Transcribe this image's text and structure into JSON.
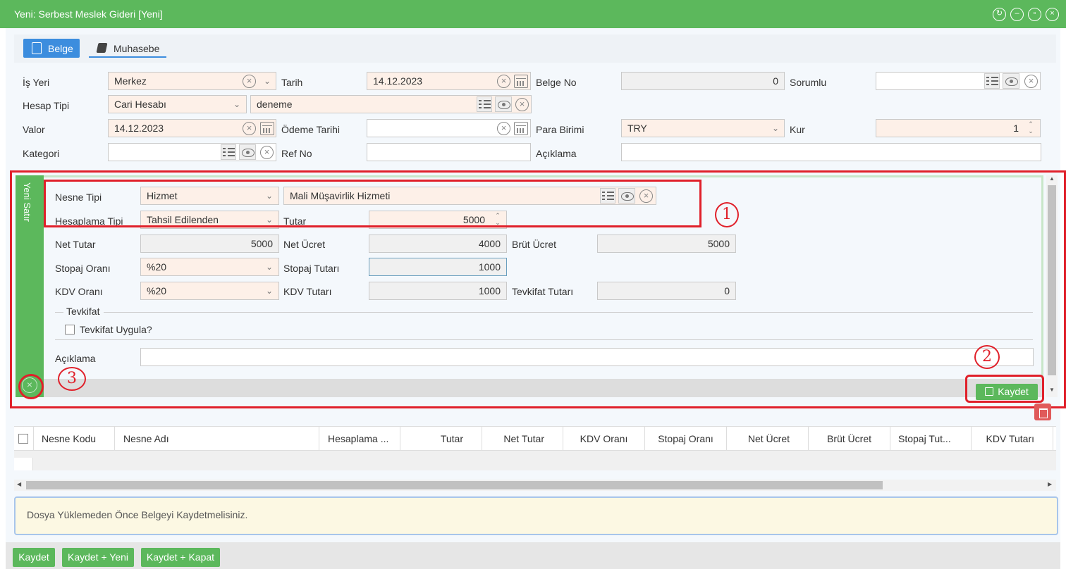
{
  "window": {
    "title": "Yeni: Serbest Meslek Gideri [Yeni]",
    "icons": [
      "refresh-icon",
      "minimize-icon",
      "maximize-icon",
      "close-icon"
    ]
  },
  "tabs": [
    {
      "label": "Belge",
      "icon": "document-icon",
      "active": true
    },
    {
      "label": "Muhasebe",
      "icon": "book-icon",
      "active": false
    }
  ],
  "form": {
    "is_yeri": {
      "label": "İş Yeri",
      "value": "Merkez"
    },
    "tarih": {
      "label": "Tarih",
      "value": "14.12.2023"
    },
    "belge_no": {
      "label": "Belge No",
      "value": "0"
    },
    "sorumlu": {
      "label": "Sorumlu",
      "value": ""
    },
    "hesap_tipi": {
      "label": "Hesap Tipi",
      "value": "Cari Hesabı",
      "account": "deneme"
    },
    "valor": {
      "label": "Valor",
      "value": "14.12.2023"
    },
    "odeme_tarihi": {
      "label": "Ödeme Tarihi",
      "value": ""
    },
    "para_birimi": {
      "label": "Para Birimi",
      "value": "TRY"
    },
    "kur": {
      "label": "Kur",
      "value": "1"
    },
    "kategori": {
      "label": "Kategori",
      "value": ""
    },
    "ref_no": {
      "label": "Ref No",
      "value": ""
    },
    "aciklama": {
      "label": "Açıklama",
      "value": ""
    }
  },
  "new_row": {
    "side_label": "Yeni Satır",
    "nesne_tipi": {
      "label": "Nesne Tipi",
      "value": "Hizmet",
      "item": "Mali Müşavirlik Hizmeti"
    },
    "hesaplama_tipi": {
      "label": "Hesaplama Tipi",
      "value": "Tahsil Edilenden"
    },
    "tutar": {
      "label": "Tutar",
      "value": "5000"
    },
    "net_tutar": {
      "label": "Net Tutar",
      "value": "5000"
    },
    "net_ucret": {
      "label": "Net Ücret",
      "value": "4000"
    },
    "brut_ucret": {
      "label": "Brüt Ücret",
      "value": "5000"
    },
    "stopaj_orani": {
      "label": "Stopaj Oranı",
      "value": "%20"
    },
    "stopaj_tutari": {
      "label": "Stopaj Tutarı",
      "value": "1000"
    },
    "kdv_orani": {
      "label": "KDV Oranı",
      "value": "%20"
    },
    "kdv_tutari": {
      "label": "KDV Tutarı",
      "value": "1000"
    },
    "tevkifat_tutari": {
      "label": "Tevkifat Tutarı",
      "value": "0"
    },
    "tevkifat_group": "Tevkifat",
    "tevkifat_uygula": "Tevkifat Uygula?",
    "aciklama": {
      "label": "Açıklama",
      "value": ""
    },
    "save_label": "Kaydet"
  },
  "annotations": [
    "1",
    "2",
    "3"
  ],
  "grid": {
    "columns": [
      "Nesne Kodu",
      "Nesne Adı",
      "Hesaplama ...",
      "Tutar",
      "Net Tutar",
      "KDV Oranı",
      "Stopaj Oranı",
      "Net Ücret",
      "Brüt Ücret",
      "Stopaj Tut...",
      "KDV Tutarı"
    ]
  },
  "notice": "Dosya Yüklemeden Önce Belgeyi Kaydetmelisiniz.",
  "footer": {
    "save": "Kaydet",
    "save_new": "Kaydet + Yeni",
    "save_close": "Kaydet + Kapat"
  },
  "colors": {
    "header_green": "#5cb85c",
    "tab_blue": "#3c8dde",
    "annotation_red": "#e0202a",
    "required_field": "#fdf0e8"
  }
}
